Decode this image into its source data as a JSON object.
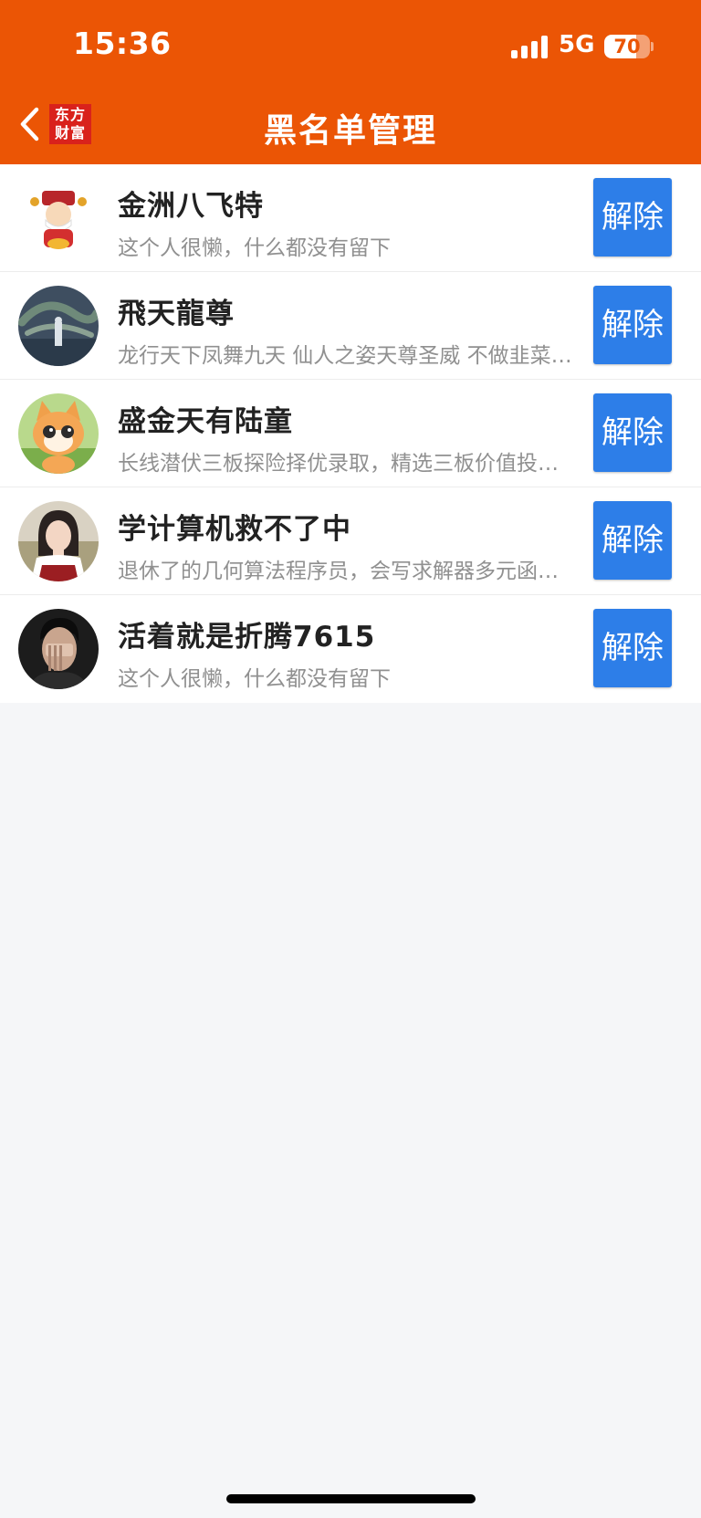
{
  "status_bar": {
    "time": "15:36",
    "network": "5G",
    "battery": "70"
  },
  "header": {
    "logo_line1": "东方",
    "logo_line2": "财富",
    "title": "黑名单管理"
  },
  "colors": {
    "accent": "#EB5505",
    "button": "#2D7EE8"
  },
  "blacklist": [
    {
      "name": "金洲八飞特",
      "bio": "这个人很懒，什么都没有留下",
      "button": "解除",
      "avatar_icon": "fortune-god-avatar"
    },
    {
      "name": "飛天龍尊",
      "bio": "龙行天下凤舞九天 仙人之姿天尊圣威 不做韭菜…",
      "button": "解除",
      "avatar_icon": "dragon-avatar"
    },
    {
      "name": "盛金天有陆童",
      "bio": "长线潜伏三板探险择优录取，精选三板价值投…",
      "button": "解除",
      "avatar_icon": "cat-avatar"
    },
    {
      "name": "学计算机救不了中",
      "bio": "退休了的几何算法程序员，会写求解器多元函…",
      "button": "解除",
      "avatar_icon": "girl-avatar"
    },
    {
      "name": "活着就是折腾7615",
      "bio": "这个人很懒，什么都没有留下",
      "button": "解除",
      "avatar_icon": "man-avatar"
    }
  ]
}
